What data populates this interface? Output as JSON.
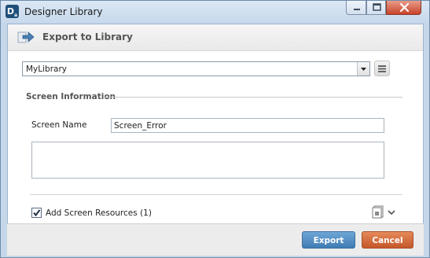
{
  "window": {
    "title": "Designer Library",
    "icon_letter": "D",
    "icon_sub": "a"
  },
  "header": {
    "title": "Export to Library"
  },
  "library_select": {
    "value": "MyLibrary"
  },
  "screen_info": {
    "section_title": "Screen Information",
    "name_label": "Screen Name",
    "name_value": "Screen_Error",
    "description_value": ""
  },
  "resources": {
    "checkbox_label": "Add Screen Resources (1)",
    "checked": true
  },
  "footer": {
    "export_label": "Export",
    "cancel_label": "Cancel"
  },
  "colors": {
    "export_button": "#4f8cc5",
    "cancel_button": "#d46a3c"
  }
}
